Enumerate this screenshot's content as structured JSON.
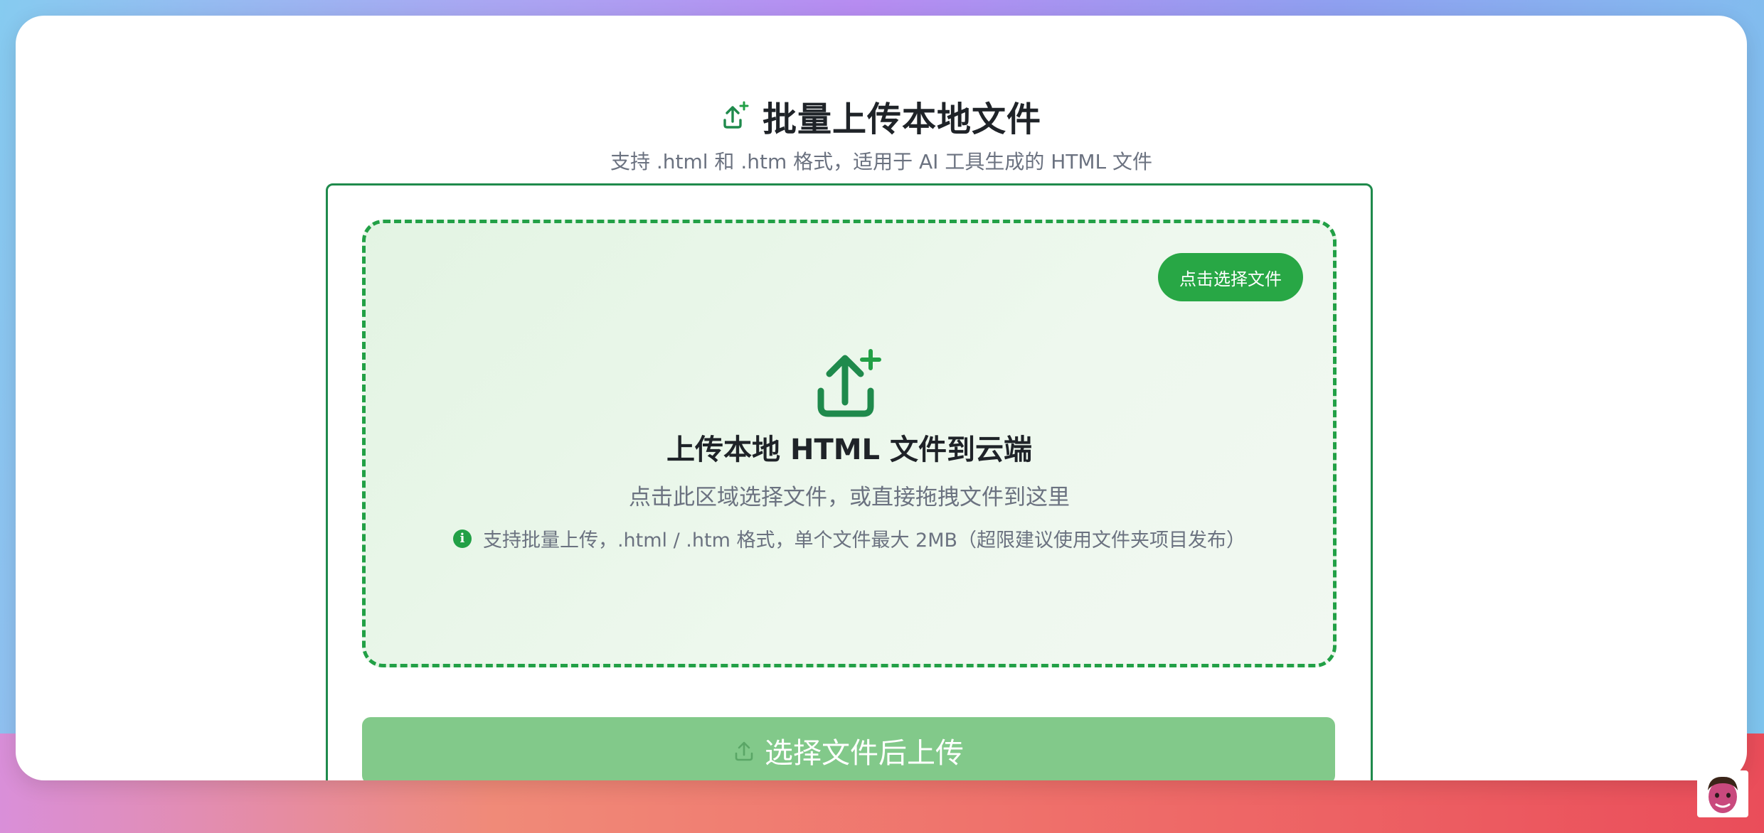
{
  "header": {
    "title": "批量上传本地文件",
    "subtitle": "支持 .html 和 .htm 格式，适用于 AI 工具生成的 HTML 文件",
    "icon": "upload-plus-icon"
  },
  "dropzone": {
    "pick_button_label": "点击选择文件",
    "title": "上传本地 HTML 文件到云端",
    "description": "点击此区域选择文件，或直接拖拽文件到这里",
    "note": "支持批量上传，.html / .htm 格式，单个文件最大 2MB（超限建议使用文件夹项目发布）",
    "icon": "upload-plus-icon",
    "note_icon": "info-icon"
  },
  "upload_button": {
    "label": "选择文件后上传",
    "icon": "upload-icon",
    "enabled": false
  },
  "colors": {
    "accent": "#28a745",
    "accent_dark": "#1f8a4c",
    "button_disabled": "#82c98a"
  },
  "avatar": {
    "icon": "memoji-avatar"
  }
}
